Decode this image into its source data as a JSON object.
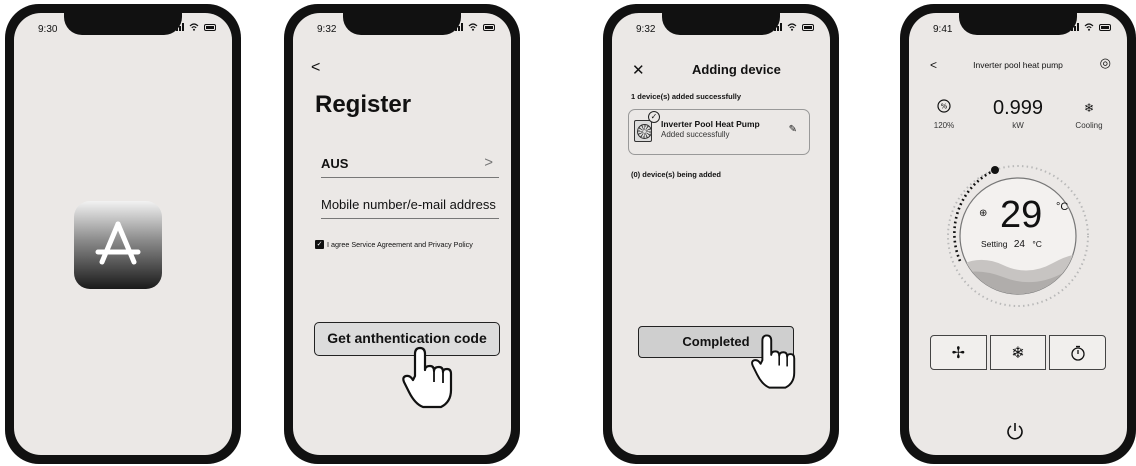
{
  "phone1": {
    "time": "9:30",
    "icon": "app-store-icon"
  },
  "phone2": {
    "time": "9:32",
    "back": "<",
    "title": "Register",
    "country": "AUS",
    "country_chevron": ">",
    "mobile_label": "Mobile number/e-mail address",
    "agree_text": "I agree Service Agreement and Privacy Policy",
    "agree_checked": true,
    "button": "Get anthentication code"
  },
  "phone3": {
    "time": "9:32",
    "close": "✕",
    "title": "Adding device",
    "added_count": "1 device(s) added successfully",
    "device": {
      "name": "Inverter Pool Heat Pump",
      "status": "Added successfully"
    },
    "being_added": "(0) device(s) being added",
    "button": "Completed"
  },
  "phone4": {
    "time": "9:41",
    "back": "<",
    "title": "Inverter pool heat pump",
    "stats": [
      {
        "icon": "fan-percent-icon",
        "label": "120%"
      },
      {
        "value": "0.999",
        "label": "kW"
      },
      {
        "icon": "snowflake-icon",
        "label": "Cooling"
      }
    ],
    "temperature": "29",
    "temperature_unit": "°C",
    "setting_label": "Setting",
    "setting_value": "24",
    "setting_unit": "°C",
    "mode_buttons": [
      "fan-icon",
      "snowflake-icon",
      "timer-icon"
    ],
    "power": "power-icon",
    "dial_level": 0.2
  },
  "colors": {
    "screen": "#ebe8e6",
    "frame": "#111111",
    "button": "#dcdcdc"
  }
}
